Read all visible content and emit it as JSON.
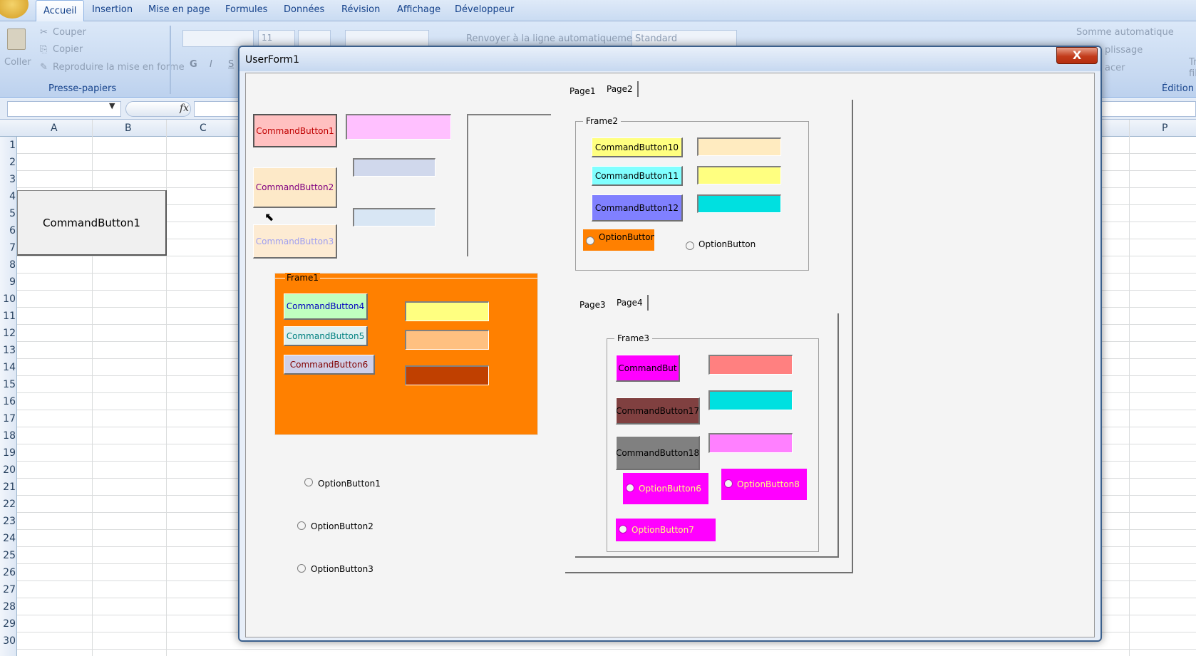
{
  "excel": {
    "ribbon_tabs": [
      "Accueil",
      "Insertion",
      "Mise en page",
      "Formules",
      "Données",
      "Révision",
      "Affichage",
      "Développeur"
    ],
    "clipboard": {
      "paste": "Coller",
      "cut": "Couper",
      "copy": "Copier",
      "format_painter": "Reproduire la mise en forme",
      "group": "Presse-papiers"
    },
    "font": {
      "size": "11",
      "bold": "G",
      "italic": "I",
      "underline": "S"
    },
    "alignment": {
      "wrap": "Renvoyer à la ligne automatiquement"
    },
    "number": {
      "format": "Standard"
    },
    "editing": {
      "autosum": "Somme automatique",
      "fill": "plissage",
      "clear": "acer",
      "group": "Édition",
      "sort_initial": "Tr",
      "find_initial": "fil"
    },
    "formula_bar": {
      "fx": "fx"
    },
    "columns": [
      "A",
      "B",
      "C",
      "P"
    ],
    "rows": [
      "1",
      "2",
      "3",
      "4",
      "5",
      "6",
      "7",
      "8",
      "9",
      "10",
      "11",
      "12",
      "13",
      "14",
      "15",
      "16",
      "17",
      "18",
      "19",
      "20",
      "21",
      "22",
      "23",
      "24",
      "25",
      "26",
      "27",
      "28",
      "29",
      "30"
    ],
    "sheet_button": "CommandButton1"
  },
  "userform": {
    "title": "UserForm1",
    "close": "X",
    "buttons": {
      "cb1": "CommandButton1",
      "cb2": "CommandButton2",
      "cb3": "CommandButton3",
      "cb4": "CommandButton4",
      "cb5": "CommandButton5",
      "cb6": "CommandButton6",
      "cb10": "CommandButton10",
      "cb11": "CommandButton11",
      "cb12": "CommandButton12",
      "cb16": "CommandBut",
      "cb17": "CommandButton17",
      "cb18": "CommandButton18"
    },
    "frames": {
      "frame1": "Frame1",
      "frame2": "Frame2",
      "frame3": "Frame3"
    },
    "options": {
      "o1": "OptionButton1",
      "o2": "OptionButton2",
      "o3": "OptionButton3",
      "o4": "OptionButton",
      "o5": "OptionButton",
      "o6": "OptionButton6",
      "o7": "OptionButton7",
      "o8": "OptionButton8"
    },
    "multipage1": {
      "tabs": [
        "Page1",
        "Page2"
      ]
    },
    "multipage2": {
      "tabs": [
        "Page3",
        "Page4"
      ]
    }
  },
  "colors": {
    "cb1": "#ffc0c0",
    "cb2": "#fde9c8",
    "cb3": "#fdebd3",
    "cb4": "#c0ffc0",
    "cb5": "#e0f0f0",
    "cb6": "#d0d0e8",
    "cb10": "#ffff80",
    "cb11": "#80ffff",
    "cb12": "#8080ff",
    "cb16": "#ff00ff",
    "cb17": "#804040",
    "cb18": "#808080",
    "frame1": "#ff8000",
    "option_magenta": "#ff00ff",
    "option4": "#ff8000"
  }
}
